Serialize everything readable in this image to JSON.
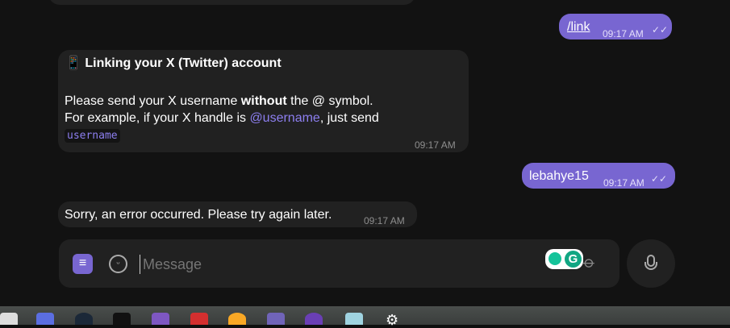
{
  "messages": [
    {
      "dir": "out",
      "text": "/link",
      "time": "09:17 AM",
      "status": "read"
    },
    {
      "dir": "in",
      "title_emoji": "📱",
      "title": "Linking your X (Twitter) account",
      "line1_a": "Please send your X username ",
      "line1_b": "without",
      "line1_c": " the @ symbol.",
      "line2_a": "For example, if your X handle is ",
      "line2_link": "@username",
      "line2_b": ", just send",
      "code": "username",
      "time": "09:17 AM"
    },
    {
      "dir": "out",
      "text": "lebahye15",
      "time": "09:17 AM",
      "status": "read"
    },
    {
      "dir": "in",
      "text": "Sorry, an error occurred. Please try again later.",
      "time": "09:17 AM"
    }
  ],
  "composer": {
    "placeholder": "Message"
  },
  "colors": {
    "accent": "#7866d1",
    "bubble_in": "#212121",
    "link": "#8d7ff0"
  },
  "taskbar": {
    "icons": [
      "app-icon",
      "docker-icon",
      "steam-icon",
      "x-icon",
      "app-icon",
      "watermelon-icon",
      "orange-icon",
      "gameboy-icon",
      "app-icon",
      "notepad-icon",
      "settings-icon"
    ]
  }
}
